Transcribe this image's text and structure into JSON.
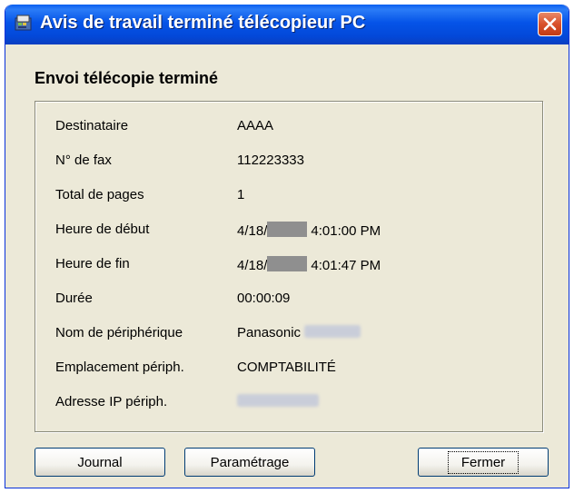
{
  "window": {
    "title": "Avis de travail terminé télécopieur PC"
  },
  "heading": "Envoi télécopie terminé",
  "details": [
    {
      "label": "Destinataire",
      "value": "AAAA"
    },
    {
      "label": "N° de fax",
      "value": "112223333"
    },
    {
      "label": "Total de pages",
      "value": "1"
    },
    {
      "label": "Heure de début",
      "value_prefix": "4/18/",
      "value_suffix": "4:01:00 PM"
    },
    {
      "label": "Heure de fin",
      "value_prefix": "4/18/",
      "value_suffix": "4:01:47 PM"
    },
    {
      "label": "Durée",
      "value": "00:00:09"
    },
    {
      "label": "Nom de périphérique",
      "value": "Panasonic"
    },
    {
      "label": "Emplacement périph.",
      "value": "COMPTABILITÉ"
    },
    {
      "label": "Adresse IP périph.",
      "value": ""
    }
  ],
  "buttons": {
    "journal": "Journal",
    "settings": "Paramétrage",
    "close": "Fermer"
  },
  "colors": {
    "titlebar": "#0554e8",
    "dialog_bg": "#ece9d8",
    "close_button": "#d9512b"
  },
  "icons": {
    "title": "fax-app-icon",
    "close": "close-icon"
  }
}
